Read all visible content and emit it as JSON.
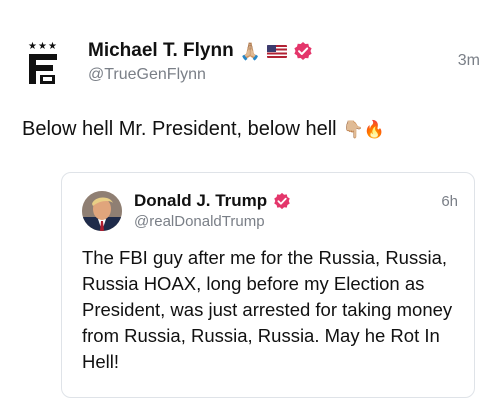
{
  "post": {
    "author": {
      "name": "Michael T. Flynn",
      "emoji_praying": "🙏🏼",
      "flag_icon": "us-flag-icon",
      "handle": "@TrueGenFlynn",
      "avatar_stars": "★★★",
      "avatar_icon": "general-flynn-logo-icon",
      "verified_icon": "verified-badge-icon",
      "verified_color": "#e4366b"
    },
    "timestamp": "3m",
    "text": "Below hell Mr. President, below hell",
    "text_emojis": "👇🏼🔥"
  },
  "quote": {
    "author": {
      "name": "Donald J. Trump",
      "handle": "@realDonaldTrump",
      "verified_icon": "verified-badge-icon",
      "verified_color": "#e4366b",
      "avatar_icon": "profile-photo"
    },
    "timestamp": "6h",
    "body": "The FBI guy after me for the Russia, Russia, Russia HOAX, long before my Election as President, was just arrested for taking money from Russia, Russia, Russia. May he Rot In Hell!"
  }
}
